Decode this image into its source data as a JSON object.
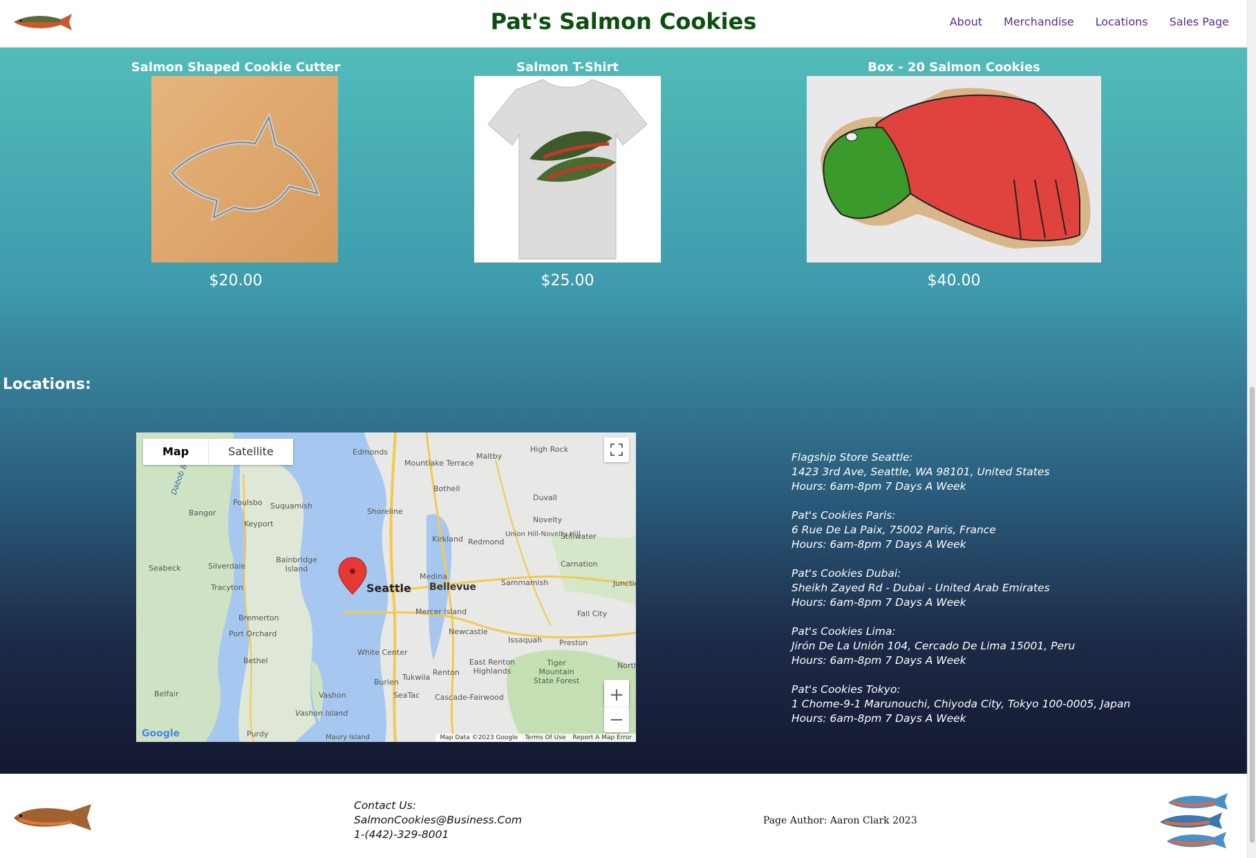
{
  "header": {
    "title": "Pat's Salmon Cookies",
    "nav": [
      "About",
      "Merchandise",
      "Locations",
      "Sales Page"
    ]
  },
  "products": [
    {
      "name": "Salmon Shaped Cookie Cutter",
      "price": "$20.00"
    },
    {
      "name": "Salmon T-Shirt",
      "price": "$25.00"
    },
    {
      "name": "Box - 20 Salmon Cookies",
      "price": "$40.00"
    }
  ],
  "locations_heading": "Locations:",
  "map": {
    "tab_map": "Map",
    "tab_satellite": "Satellite",
    "pin_label": "Seattle",
    "places": [
      "Edmonds",
      "Mountlake Terrace",
      "Maltby",
      "High Rock",
      "Shoreline",
      "Bothell",
      "Poulsbo",
      "Suquamish",
      "Bangor",
      "Keyport",
      "Duvall",
      "Kirkland",
      "Redmond",
      "Novelty",
      "Union Hill-Novelty Hill",
      "Stillwater",
      "Seabeck",
      "Silverdale",
      "Bainbridge Island",
      "Carnation",
      "Medina",
      "Bellevue",
      "Tracyton",
      "Sammamish",
      "Bremerton",
      "Mercer Island",
      "Fall City",
      "Port Orchard",
      "Newcastle",
      "Issaquah",
      "Preston",
      "White Center",
      "Bethel",
      "Renton",
      "East Renton Highlands",
      "Tiger Mountain State Forest",
      "Burien",
      "Tukwila",
      "SeaTac",
      "Cascade-Fairwood",
      "Belfair",
      "Vashon",
      "Vashon Island",
      "Purdy",
      "Maury Island",
      "Dabob Bay",
      "Junctio",
      "North"
    ],
    "footer": [
      "Map Data ©2023 Google",
      "Terms Of Use",
      "Report A Map Error"
    ],
    "logo": "Google"
  },
  "stores": [
    {
      "name": "Flagship Store Seattle:",
      "address": "1423 3rd Ave, Seattle, WA 98101, United States",
      "hours": "Hours: 6am-8pm 7 Days A Week"
    },
    {
      "name": "Pat's Cookies Paris:",
      "address": "6 Rue De La Paix, 75002 Paris, France",
      "hours": "Hours: 6am-8pm 7 Days A Week"
    },
    {
      "name": "Pat's Cookies Dubai:",
      "address": "Sheikh Zayed Rd - Dubai - United Arab Emirates",
      "hours": "Hours: 6am-8pm 7 Days A Week"
    },
    {
      "name": "Pat's Cookies Lima:",
      "address": "Jirón De La Unión 104, Cercado De Lima 15001, Peru",
      "hours": "Hours: 6am-8pm 7 Days A Week"
    },
    {
      "name": "Pat's Cookies Tokyo:",
      "address": "1 Chome-9-1 Marunouchi, Chiyoda City, Tokyo 100-0005, Japan",
      "hours": "Hours: 6am-8pm 7 Days A Week"
    }
  ],
  "footer": {
    "contact_heading": "Contact Us:",
    "email": "SalmonCookies@Business.Com",
    "phone": "1-(442)-329-8001",
    "author": "Page Author: Aaron Clark 2023"
  },
  "colors": {
    "title": "#0b4f0f",
    "nav": "#5a2a8a",
    "teal": "#52bcb9",
    "navy": "#141830"
  }
}
